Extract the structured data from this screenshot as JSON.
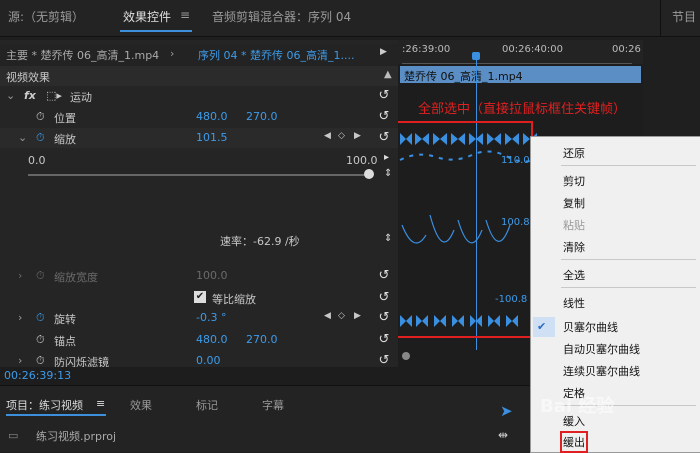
{
  "tabs": {
    "source": "源:（无剪辑）",
    "effect_controls": "效果控件",
    "effect_menu": "≡",
    "audio_mixer": "音频剪辑混合器：序列 04",
    "right_panel": "节目"
  },
  "clip_header": {
    "master": "主要 * 楚乔传 06_高清_1.mp4",
    "sequence": "序列 04 * 楚乔传 06_高清_1....",
    "arrow": "▶",
    "time1": ":26:39:00",
    "time2": "00:26:40:00",
    "time3": "00:26"
  },
  "section_title": "视频效果",
  "clip_bar_label": "楚乔传 06_高清_1.mp4",
  "effects": {
    "fx": "fx",
    "motion": "运动",
    "position_label": "位置",
    "position_x": "480.0",
    "position_y": "270.0",
    "scale_label": "缩放",
    "scale_value": "101.5",
    "slider_min": "0.0",
    "slider_max": "100.0",
    "graph_top": "110.0",
    "graph_mid_top": "100.8",
    "graph_bottom": "-100.8",
    "rate": "速率：-62.9 /秒",
    "scale_width_label": "缩放宽度",
    "scale_width_value": "100.0",
    "uniform_scale": "等比缩放",
    "rotation_label": "旋转",
    "rotation_value": "-0.3 °",
    "anchor_label": "锚点",
    "anchor_x": "480.0",
    "anchor_y": "270.0",
    "antiflicker_label": "防闪烁滤镜",
    "antiflicker_value": "0.00"
  },
  "timecode": "00:26:39:13",
  "annotation": "全部选中（直接拉鼠标框住关键帧）",
  "bottom": {
    "project": "项目：练习视频",
    "menu": "≡",
    "effects": "效果",
    "markers": "标记",
    "captions": "字幕",
    "file": "练习视频.prproj"
  },
  "context_menu": {
    "restore": "还原",
    "cut": "剪切",
    "copy": "复制",
    "paste": "粘贴",
    "clear": "清除",
    "select_all": "全选",
    "linear": "线性",
    "bezier": "贝塞尔曲线",
    "auto_bezier": "自动贝塞尔曲线",
    "continuous_bezier": "连续贝塞尔曲线",
    "hold": "定格",
    "ease_in": "缓入",
    "ease_out": "缓出",
    "check": "✔"
  },
  "watermark": "Bai 经验"
}
